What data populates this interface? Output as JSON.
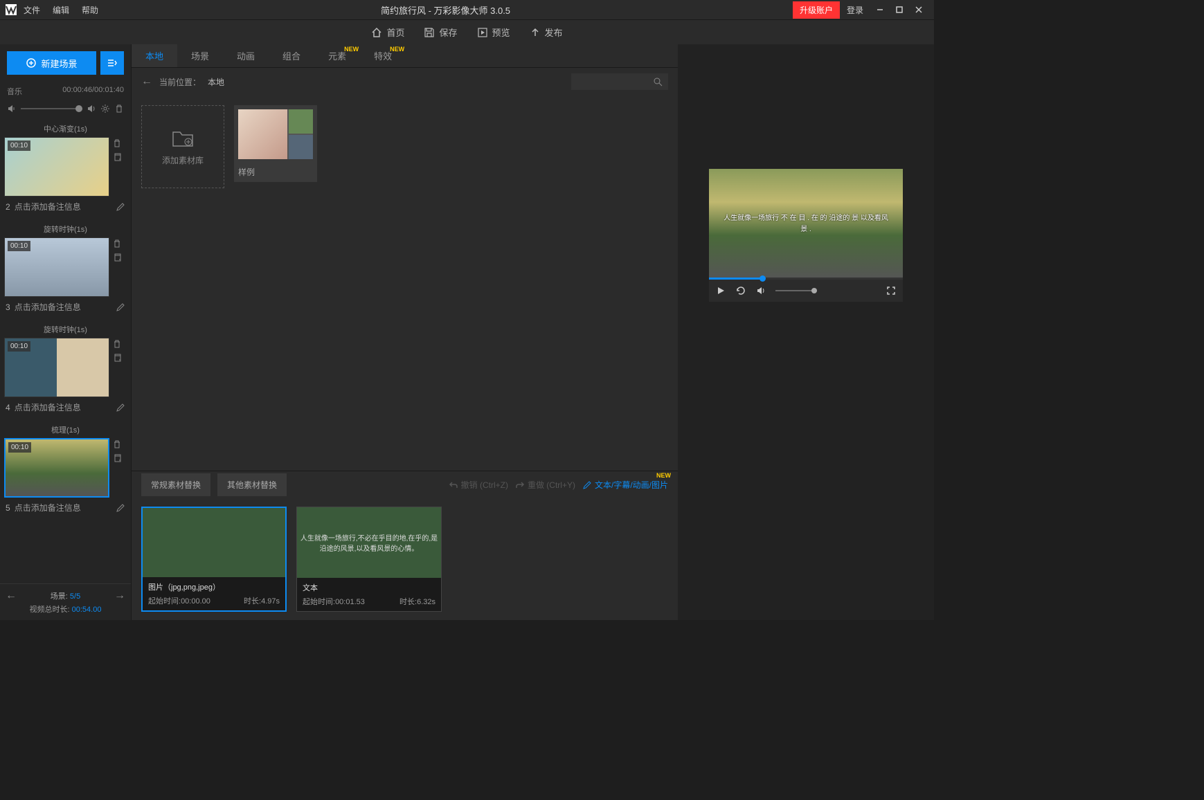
{
  "titlebar": {
    "menu": {
      "file": "文件",
      "edit": "编辑",
      "help": "帮助"
    },
    "title": "简约旅行风 - 万彩影像大师 3.0.5",
    "upgrade": "升级账户",
    "login": "登录"
  },
  "toolbar": {
    "home": "首页",
    "save": "保存",
    "preview": "预览",
    "publish": "发布"
  },
  "left": {
    "new_scene": "新建场景",
    "music_label": "音乐",
    "music_time": "00:00:46/00:01:40",
    "scenes": [
      {
        "title": "中心渐变(1s)",
        "time": "00:10",
        "num": "2",
        "caption": "点击添加备注信息"
      },
      {
        "title": "旋转时钟(1s)",
        "time": "00:10",
        "num": "3",
        "caption": "点击添加备注信息"
      },
      {
        "title": "旋转时钟(1s)",
        "time": "00:10",
        "num": "4",
        "caption": "点击添加备注信息"
      },
      {
        "title": "梳理(1s)",
        "time": "00:10",
        "num": "5",
        "caption": "点击添加备注信息"
      }
    ],
    "footer": {
      "scene_label": "场景:",
      "scene_count": "5/5",
      "total_label": "视频总时长:",
      "total_dur": "00:54.00"
    }
  },
  "tabs": {
    "local": "本地",
    "scene": "场景",
    "anim": "动画",
    "combo": "组合",
    "element": "元素",
    "effect": "特效",
    "new_badge": "NEW"
  },
  "breadcrumb": {
    "label": "当前位置：",
    "loc": "本地"
  },
  "gallery": {
    "addlib": "添加素材库",
    "sample": "样例"
  },
  "editor": {
    "tab_normal": "常规素材替换",
    "tab_other": "其他素材替换",
    "undo": "撤销 (Ctrl+Z)",
    "redo": "重做 (Ctrl+Y)",
    "edit_link": "文本/字幕/动画/图片",
    "new_badge": "NEW"
  },
  "clips": [
    {
      "title": "图片（jpg,png,jpeg）",
      "start_label": "起始时间:",
      "start": "00:00.00",
      "dur_label": "时长:",
      "dur": "4.97s",
      "preview_text": ""
    },
    {
      "title": "文本",
      "start_label": "起始时间:",
      "start": "00:01.53",
      "dur_label": "时长:",
      "dur": "6.32s",
      "preview_text": "人生就像一场旅行,不必在乎目的地,在乎的,是沿途的风景,以及看风景的心情。"
    }
  ],
  "preview": {
    "overlay": "人生就像一场旅行 不 在 目 . 在 的 沿途的 景 以及看风景 ."
  }
}
